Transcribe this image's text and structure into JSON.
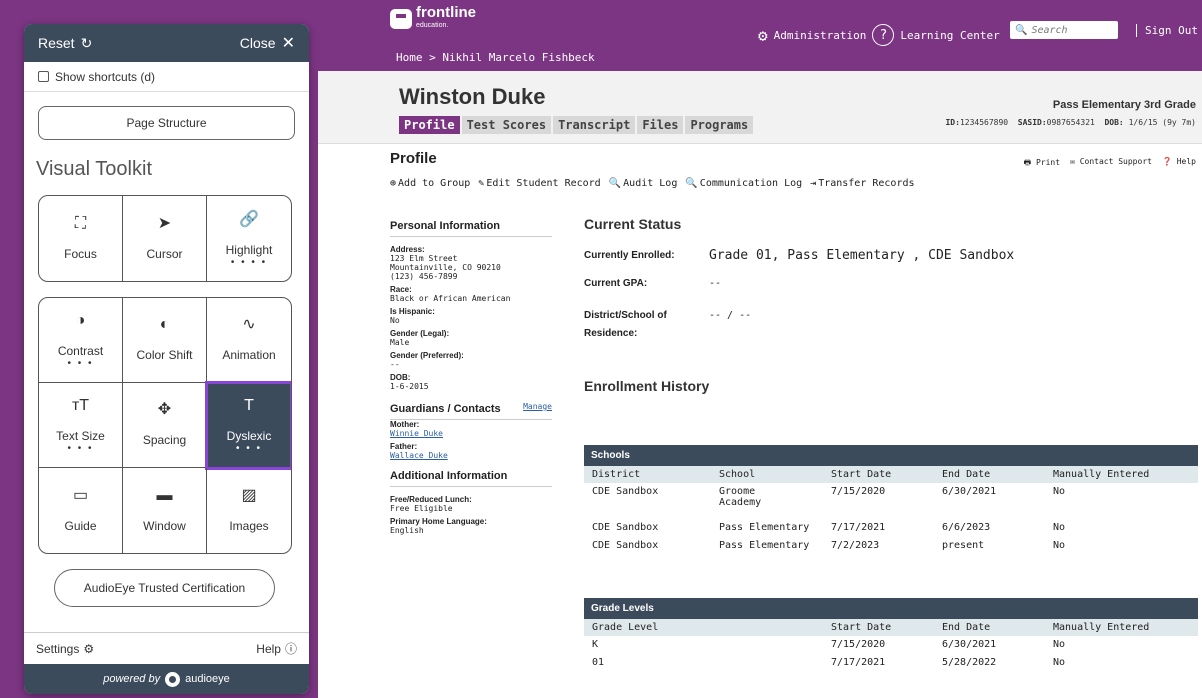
{
  "toolkit": {
    "reset_label": "Reset",
    "close_label": "Close",
    "shortcuts_label": "Show shortcuts (d)",
    "page_structure_label": "Page Structure",
    "title": "Visual Toolkit",
    "group1": [
      {
        "label": "Focus",
        "icon": "focus-icon",
        "glyph": "⛶",
        "dots": ""
      },
      {
        "label": "Cursor",
        "icon": "cursor-icon",
        "glyph": "➤",
        "dots": ""
      },
      {
        "label": "Highlight",
        "icon": "highlight-icon",
        "glyph": "🔗",
        "dots": "• • • •"
      }
    ],
    "group2": [
      {
        "label": "Contrast",
        "icon": "contrast-icon",
        "glyph": "◑",
        "dots": "• • •"
      },
      {
        "label": "Color Shift",
        "icon": "color-shift-icon",
        "glyph": "◐",
        "dots": ""
      },
      {
        "label": "Animation",
        "icon": "animation-icon",
        "glyph": "∿",
        "dots": ""
      },
      {
        "label": "Text Size",
        "icon": "text-size-icon",
        "glyph": "тT",
        "dots": "• • •"
      },
      {
        "label": "Spacing",
        "icon": "spacing-icon",
        "glyph": "✥",
        "dots": ""
      },
      {
        "label": "Dyslexic",
        "icon": "dyslexic-icon",
        "glyph": "T",
        "dots": "• • •"
      },
      {
        "label": "Guide",
        "icon": "guide-icon",
        "glyph": "▭",
        "dots": ""
      },
      {
        "label": "Window",
        "icon": "window-icon",
        "glyph": "▬",
        "dots": ""
      },
      {
        "label": "Images",
        "icon": "images-icon",
        "glyph": "▨",
        "dots": ""
      }
    ],
    "certification_label": "AudioEye Trusted Certification",
    "settings_label": "Settings",
    "help_label": "Help",
    "powered_label": "powered by",
    "brand_label": "audioeye"
  },
  "topbar": {
    "logo_text": "frontline",
    "logo_sub": "education.",
    "breadcrumb": "Home > Nikhil Marcelo Fishbeck",
    "admin_label": "Administration",
    "learning_label": "Learning Center",
    "search_placeholder": "Search",
    "signout_label": "Sign Out"
  },
  "student": {
    "name": "Winston Duke",
    "tabs": [
      "Profile",
      "Test Scores",
      "Transcript",
      "Files",
      "Programs"
    ],
    "school": "Pass Elementary   3rd Grade",
    "id_label": "ID:",
    "id": "1234567890",
    "sasid_label": "SASID:",
    "sasid": "0987654321",
    "dob_label": "DOB:",
    "dob": "1/6/15 (9y 7m)"
  },
  "profile": {
    "title": "Profile",
    "actions": [
      "Add to Group",
      "Edit Student Record",
      "Audit Log",
      "Communication Log",
      "Transfer Records"
    ],
    "print": "Print",
    "contact": "Contact Support",
    "help": "Help"
  },
  "personal": {
    "title": "Personal Information",
    "address_label": "Address:",
    "address_lines": [
      "123 Elm Street",
      "Mountainville, CO 90210",
      "(123) 456-7899"
    ],
    "race_label": "Race:",
    "race": "Black or African American",
    "hispanic_label": "Is Hispanic:",
    "hispanic": "No",
    "gender_legal_label": "Gender (Legal):",
    "gender_legal": "Male",
    "gender_pref_label": "Gender (Preferred):",
    "gender_pref": "--",
    "dob_label": "DOB:",
    "dob": "1-6-2015"
  },
  "guardians": {
    "title": "Guardians / Contacts",
    "manage": "Manage",
    "mother_label": "Mother:",
    "mother": "Winnie Duke",
    "father_label": "Father:",
    "father": "Wallace Duke"
  },
  "additional": {
    "title": "Additional Information",
    "lunch_label": "Free/Reduced Lunch:",
    "lunch": "Free Eligible",
    "lang_label": "Primary Home Language:",
    "lang": "English"
  },
  "status": {
    "title": "Current Status",
    "enrolled_label": "Currently Enrolled:",
    "enrolled": "Grade 01, Pass Elementary , CDE Sandbox",
    "gpa_label": "Current GPA:",
    "gpa": "--",
    "district_label": "District/School of",
    "district_label2": "Residence:",
    "district": "-- / --"
  },
  "enrollment": {
    "title": "Enrollment History",
    "schools_title": "Schools",
    "schools_cols": [
      "District",
      "School",
      "Start Date",
      "End Date",
      "Manually Entered"
    ],
    "schools_rows": [
      [
        "CDE Sandbox",
        "Groome Academy",
        "7/15/2020",
        "6/30/2021",
        "No"
      ],
      [
        "CDE Sandbox",
        "Pass Elementary",
        "7/17/2021",
        "6/6/2023",
        "No"
      ],
      [
        "CDE Sandbox",
        "Pass Elementary",
        "7/2/2023",
        "present",
        "No"
      ]
    ],
    "grades_title": "Grade Levels",
    "grades_cols": [
      "Grade Level",
      "Start Date",
      "End Date",
      "Manually Entered"
    ],
    "grades_rows": [
      [
        "K",
        "7/15/2020",
        "6/30/2021",
        "No"
      ],
      [
        "01",
        "7/17/2021",
        "5/28/2022",
        "No"
      ]
    ]
  },
  "colors": {
    "brand": "#7b3583",
    "panel_dark": "#3c4b5c",
    "highlight": "#8b45d6"
  }
}
